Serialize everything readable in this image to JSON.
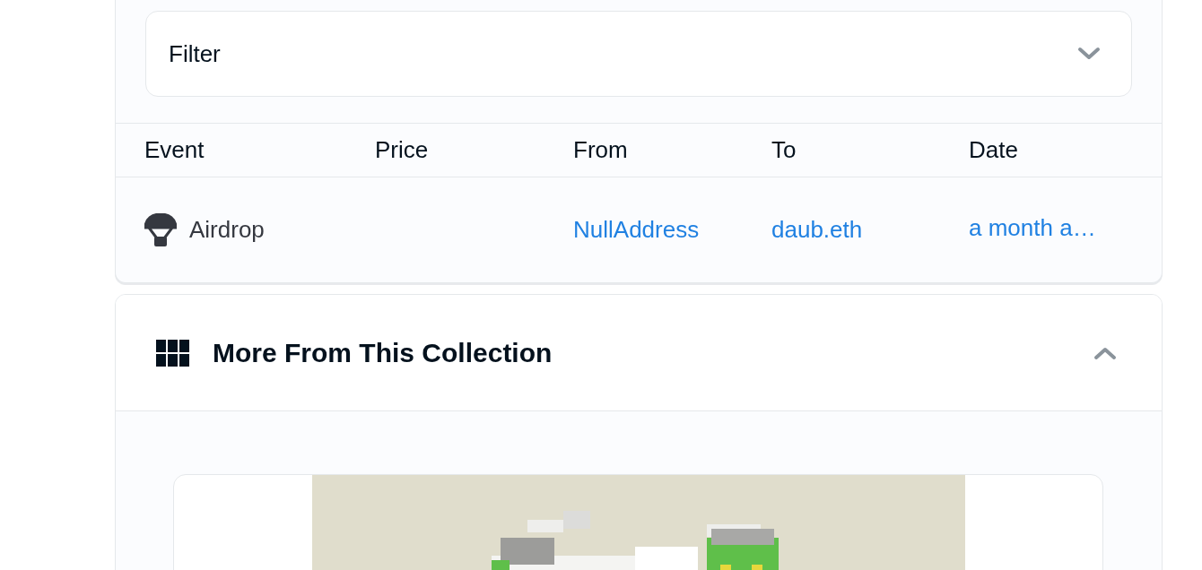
{
  "filter": {
    "label": "Filter",
    "expanded": false
  },
  "activity_table": {
    "columns": [
      "Event",
      "Price",
      "From",
      "To",
      "Date"
    ],
    "rows": [
      {
        "event": "Airdrop",
        "from": "NullAddress",
        "to": "daub.eth",
        "date": "a month a…"
      }
    ]
  },
  "collection_panel": {
    "title": "More From This Collection",
    "expanded": true
  }
}
